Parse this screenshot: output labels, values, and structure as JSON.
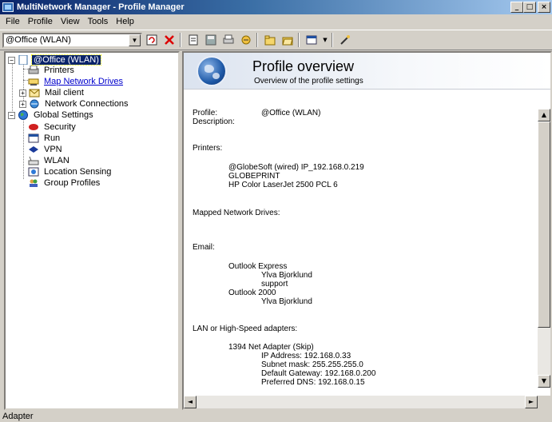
{
  "window": {
    "title": "MultiNetwork Manager - Profile Manager",
    "buttons": {
      "minimize": "_",
      "maximize": "□",
      "close": "×"
    }
  },
  "menu": [
    "File",
    "Profile",
    "View",
    "Tools",
    "Help"
  ],
  "toolbar": {
    "profile_combo_value": "@Office (WLAN)"
  },
  "tree": {
    "root_label": "@Office (WLAN)",
    "root_children": [
      "Printers",
      "Map Network Drives",
      "Mail client",
      "Network Connections"
    ],
    "global_label": "Global Settings",
    "global_children": [
      "Security",
      "Run",
      "VPN",
      "WLAN",
      "Location Sensing",
      "Group Profiles"
    ]
  },
  "overview": {
    "title": "Profile overview",
    "subtitle": "Overview of the profile settings",
    "profile_label": "Profile:",
    "profile_value": "@Office (WLAN)",
    "description_label": "Description:",
    "printers_label": "Printers:",
    "printers": [
      "@GlobeSoft (wired) IP_192.168.0.219",
      "GLOBEPRINT",
      "HP Color LaserJet 2500 PCL 6"
    ],
    "drives_label": "Mapped Network Drives:",
    "email_label": "Email:",
    "email_clients": [
      {
        "client": "Outlook Express",
        "entries": [
          "Ylva Bjorklund",
          "support"
        ]
      },
      {
        "client": "Outlook 2000",
        "entries": [
          "Ylva Bjorklund"
        ]
      }
    ],
    "lan_label": "LAN or High-Speed adapters:",
    "adapter": {
      "name": "1394 Net Adapter (Skip)",
      "ip": "IP Address: 192.168.0.33",
      "mask": "Subnet mask: 255.255.255.0",
      "gateway": "Default Gateway: 192.168.0.200",
      "dns": "Preferred DNS: 192.168.0.15"
    }
  },
  "status": {
    "text": "Adapter"
  }
}
